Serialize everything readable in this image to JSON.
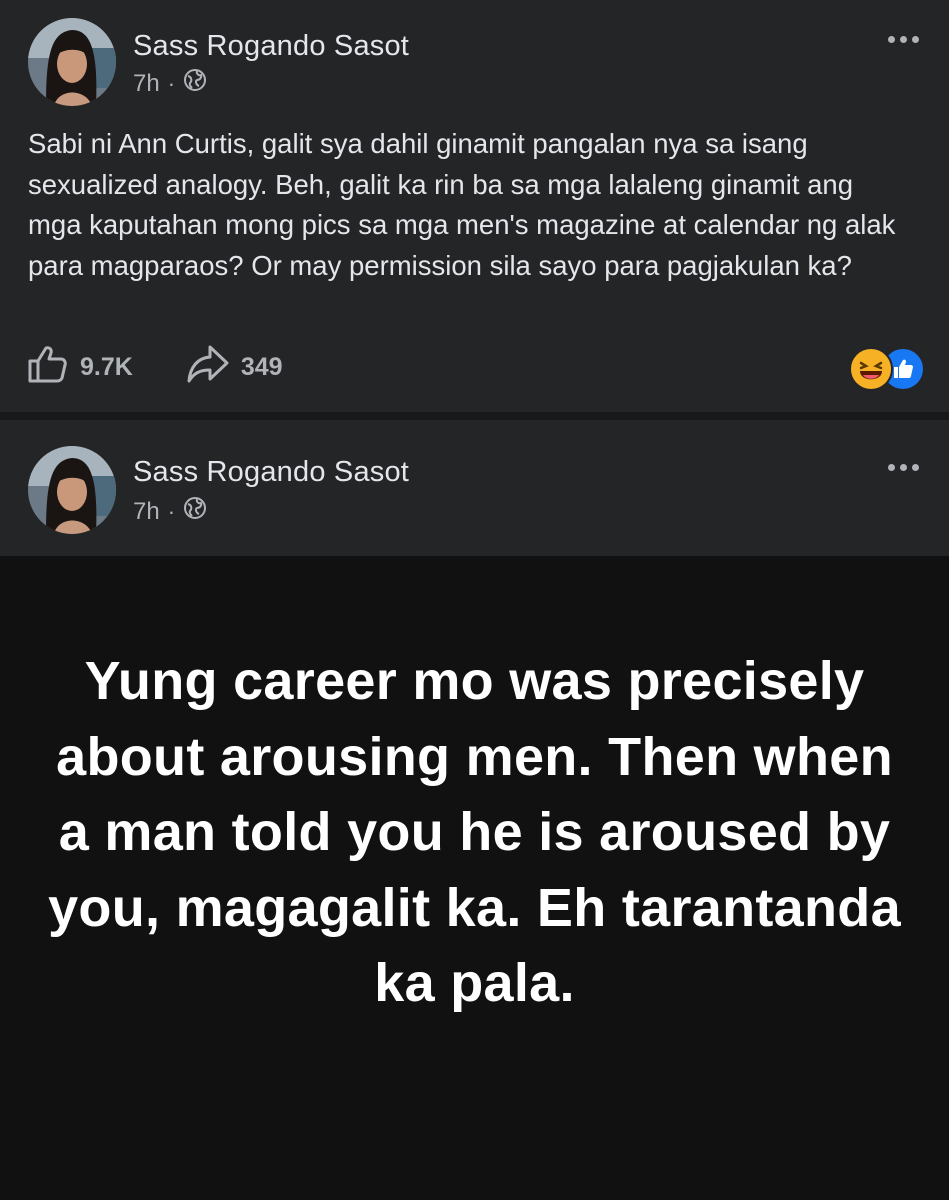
{
  "colors": {
    "card_bg": "#242526",
    "quote_bg": "#111111",
    "secondary_text": "#b0b3b8",
    "primary_text": "#e4e6eb",
    "like_blue": "#1877f2",
    "haha_yellow": "#f7b125"
  },
  "posts": [
    {
      "author": "Sass Rogando Sasot",
      "time": "7h",
      "separator": "·",
      "audience_icon": "globe-icon",
      "text": "Sabi ni Ann Curtis, galit sya dahil ginamit pangalan nya sa isang sexualized analogy. Beh, galit ka rin ba sa mga lalaleng ginamit ang mga kaputahan mong pics sa mga men's magazine at calendar ng alak para magparaos? Or may permission sila sayo para pagjakulan ka?",
      "likes": "9.7K",
      "shares": "349",
      "reactions": [
        "haha-reaction-icon",
        "like-reaction-icon"
      ]
    },
    {
      "author": "Sass Rogando Sasot",
      "time": "7h",
      "separator": "·",
      "audience_icon": "globe-icon",
      "quote": "Yung career mo was precisely about arousing men. Then when a man told you he is aroused by you, magagalit ka. Eh tarantanda ka pala."
    }
  ]
}
